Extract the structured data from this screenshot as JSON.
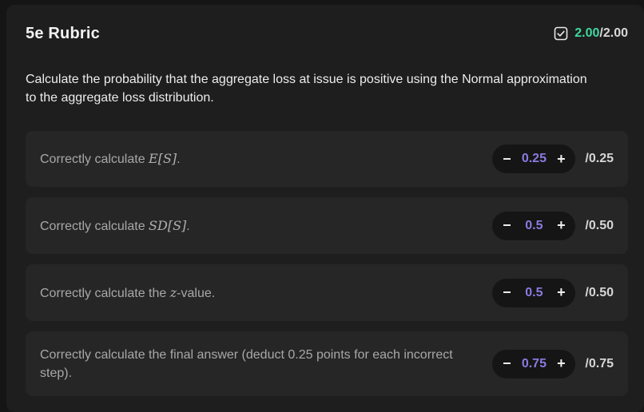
{
  "header": {
    "title": "5e Rubric",
    "score_earned": "2.00",
    "score_total": "/2.00",
    "check_icon": "check-square-icon",
    "accent_color": "#3fd9a0"
  },
  "prompt": "Calculate the probability that the aggregate loss at issue is positive using the Normal approximation to the aggregate loss distribution.",
  "criteria": [
    {
      "pre": "Correctly calculate ",
      "math": "E[S]",
      "post": ".",
      "value": "0.25",
      "max": "/0.25"
    },
    {
      "pre": "Correctly calculate ",
      "math": "SD[S]",
      "post": ".",
      "value": "0.5",
      "max": "/0.50"
    },
    {
      "pre": "Correctly calculate the ",
      "math": "z",
      "post": "-value.",
      "value": "0.5",
      "max": "/0.50"
    },
    {
      "pre": "Correctly calculate the final answer (deduct 0.25 points for each incorrect step).",
      "math": "",
      "post": "",
      "value": "0.75",
      "max": "/0.75"
    }
  ],
  "controls": {
    "minus_label": "−",
    "plus_label": "+"
  },
  "colors": {
    "value_color": "#8a7be0",
    "panel_bg": "#1e1e1e",
    "row_bg": "#262626"
  }
}
